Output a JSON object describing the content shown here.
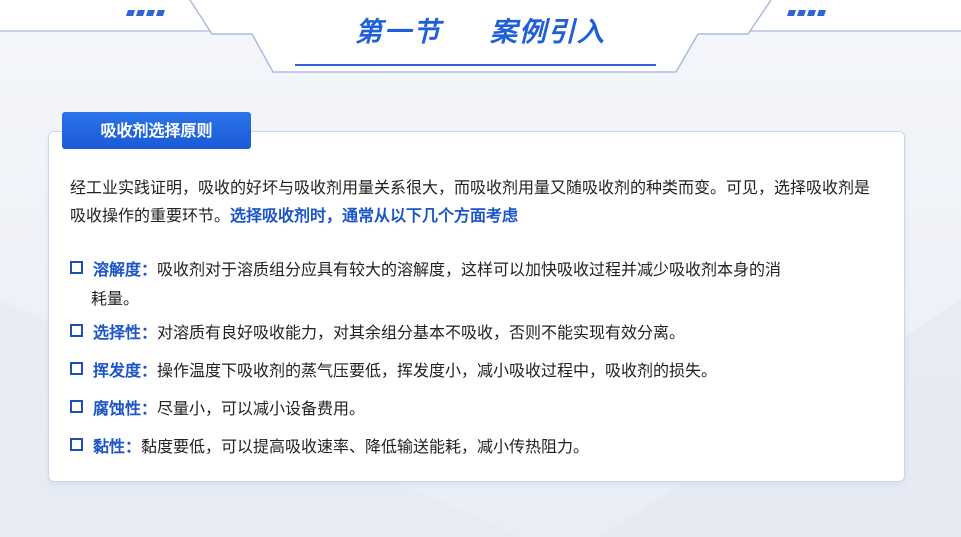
{
  "header": {
    "title_part1": "第一节",
    "title_part2": "案例引入"
  },
  "section_tag": "吸收剂选择原则",
  "intro": {
    "text": "经工业实践证明，吸收的好坏与吸收剂用量关系很大，而吸收剂用量又随吸收剂的种类而变。可见，选择吸收剂是吸收操作的重要环节。",
    "highlight": "选择吸收剂时，通常从以下几个方面考虑"
  },
  "items": [
    {
      "term": "溶解度：",
      "text": "吸收剂对于溶质组分应具有较大的溶解度，这样可以加快吸收过程并减少吸收剂本身的消",
      "text2": "耗量。"
    },
    {
      "term": "选择性：",
      "text": "对溶质有良好吸收能力，对其余组分基本不吸收，否则不能实现有效分离。"
    },
    {
      "term": "挥发度：",
      "text": "操作温度下吸收剂的蒸气压要低，挥发度小，减小吸收过程中，吸收剂的损失。"
    },
    {
      "term": "腐蚀性：",
      "text": "尽量小，可以减小设备费用。"
    },
    {
      "term": "黏性：",
      "text": "黏度要低，可以提高吸收速率、降低输送能耗，减小传热阻力。"
    }
  ]
}
